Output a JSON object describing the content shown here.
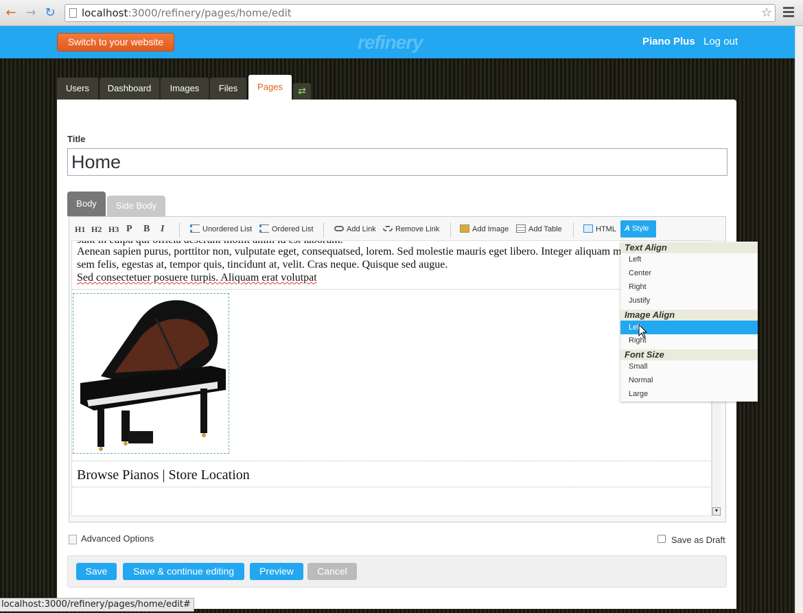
{
  "browser": {
    "url_host": "localhost",
    "url_path": ":3000/refinery/pages/home/edit",
    "status_url": "localhost:3000/refinery/pages/home/edit#"
  },
  "header": {
    "switch_label": "Switch to your website",
    "logo_text": "refinery",
    "site_name": "Piano Plus",
    "logout_label": "Log out"
  },
  "main_tabs": [
    {
      "label": "Users"
    },
    {
      "label": "Dashboard"
    },
    {
      "label": "Images"
    },
    {
      "label": "Files"
    },
    {
      "label": "Pages",
      "active": true
    }
  ],
  "form": {
    "title_label": "Title",
    "title_value": "Home",
    "body_tab": "Body",
    "side_body_tab": "Side Body"
  },
  "toolbar": {
    "h1": "H1",
    "h2": "H2",
    "h3": "H3",
    "p": "P",
    "b": "B",
    "i": "I",
    "unordered_list": "Unordered List",
    "ordered_list": "Ordered List",
    "add_link": "Add Link",
    "remove_link": "Remove Link",
    "add_image": "Add Image",
    "add_table": "Add Table",
    "html": "HTML",
    "style": "Style"
  },
  "content": {
    "cut_line": "sunt in culpa qui officia deserunt mollit anim id est laborum.",
    "line1": "Aenean sapien purus, porttitor non, vulputate eget, consequatsed, lorem. Sed molestie mauris eget libero. Integer aliquam magna",
    "line2": "sem felis, egestas at, tempor quis, tincidunt at, velit. Cras neque. Quisque sed augue.",
    "line3": "Sed consectetuer posuere turpis. Aliquam erat volutpat",
    "links": "Browse Pianos | Store Location"
  },
  "style_menu": {
    "text_align_heading": "Text Align",
    "text_align": [
      "Left",
      "Center",
      "Right",
      "Justify"
    ],
    "image_align_heading": "Image Align",
    "image_align": [
      "Left",
      "Right"
    ],
    "image_align_selected": "Left",
    "font_size_heading": "Font Size",
    "font_size": [
      "Small",
      "Normal",
      "Large"
    ]
  },
  "bottom": {
    "advanced_options": "Advanced Options",
    "save_as_draft": "Save as Draft",
    "save_as_draft_checked": false,
    "save": "Save",
    "save_continue": "Save & continue editing",
    "preview": "Preview",
    "cancel": "Cancel"
  },
  "colors": {
    "accent_blue": "#22a7f0",
    "switch_orange": "#e05a1e",
    "active_tab_text": "#e0621e"
  }
}
